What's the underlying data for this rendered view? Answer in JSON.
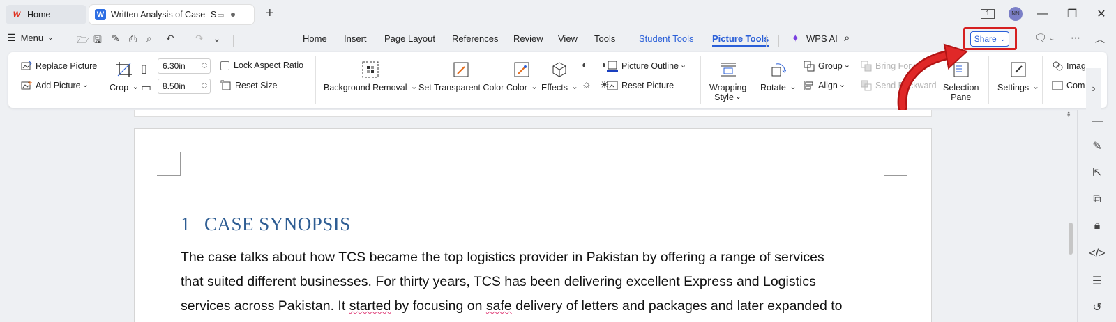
{
  "titlebar": {
    "tabs": [
      {
        "label": "Home",
        "icon": "wps-logo-icon"
      },
      {
        "label": "Written Analysis of Case- Scien",
        "icon": "word-doc-icon"
      }
    ],
    "new_tab": "+",
    "page_badge": "1",
    "avatar_initials": "NN"
  },
  "menu": {
    "menu_label": "Menu",
    "tabs": [
      "Home",
      "Insert",
      "Page Layout",
      "References",
      "Review",
      "View",
      "Tools",
      "Student Tools",
      "Picture Tools"
    ],
    "active_tab": "Picture Tools",
    "wps_ai": "WPS AI",
    "share_label": "Share"
  },
  "ribbon": {
    "replace_picture": "Replace Picture",
    "add_picture": "Add Picture",
    "crop": "Crop",
    "width_value": "6.30in",
    "height_value": "8.50in",
    "lock_aspect": "Lock Aspect Ratio",
    "reset_size": "Reset Size",
    "background_removal": "Background Removal",
    "set_transparent": "Set Transparent Color",
    "color": "Color",
    "effects": "Effects",
    "picture_outline": "Picture Outline",
    "reset_picture": "Reset Picture",
    "wrapping_style_1": "Wrapping",
    "wrapping_style_2": "Style",
    "rotate": "Rotate",
    "group": "Group",
    "align": "Align",
    "bring_forward": "Bring Forw",
    "send_backward": "Send Backward",
    "selection_pane_1": "Selection",
    "selection_pane_2": "Pane",
    "settings": "Settings",
    "image_partial": "Imag",
    "com_partial": "Com"
  },
  "document": {
    "heading_number": "1",
    "heading_text": "CASE SYNOPSIS",
    "para_line1": "The case talks about how TCS became the top logistics provider in Pakistan by offering a range of services",
    "para_line2": "that suited different businesses. For thirty years, TCS has been delivering excellent Express and Logistics",
    "para_line3_a": "services across Pakistan. It ",
    "para_line3_b": "started",
    "para_line3_c": " by focusing on ",
    "para_line3_d": "safe",
    "para_line3_e": " delivery of letters and packages and later expanded to"
  },
  "colors": {
    "accent": "#2a5fd8",
    "heading": "#2e5d93",
    "highlight": "#d62020"
  }
}
